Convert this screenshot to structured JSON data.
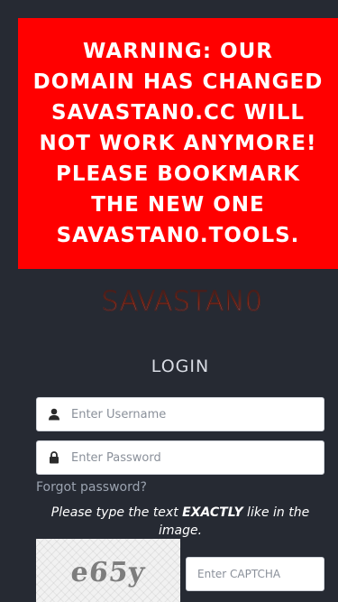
{
  "banner": {
    "warning": "WARNING: OUR DOMAIN HAS CHANGED SAVASTAN0.CC WILL NOT WORK ANYMORE! PLEASE BOOKMARK THE NEW ONE SAVASTAN0.TOOLS."
  },
  "brand": {
    "logo_text": "SAVASTAN0"
  },
  "login": {
    "title": "LOGIN",
    "username_placeholder": "Enter Username",
    "username_icon": "user-icon",
    "password_placeholder": "Enter Password",
    "password_icon": "lock-icon",
    "forgot_password": "Forgot password?",
    "captcha_prefix": "Please type the text ",
    "captcha_emphasis": "EXACTLY",
    "captcha_suffix": " like in the image.",
    "captcha_code": "e65y",
    "captcha_placeholder": "Enter CAPTCHA"
  },
  "colors": {
    "background": "#262a33",
    "warning_bg": "#ff0000",
    "warning_text": "#ffffff"
  }
}
